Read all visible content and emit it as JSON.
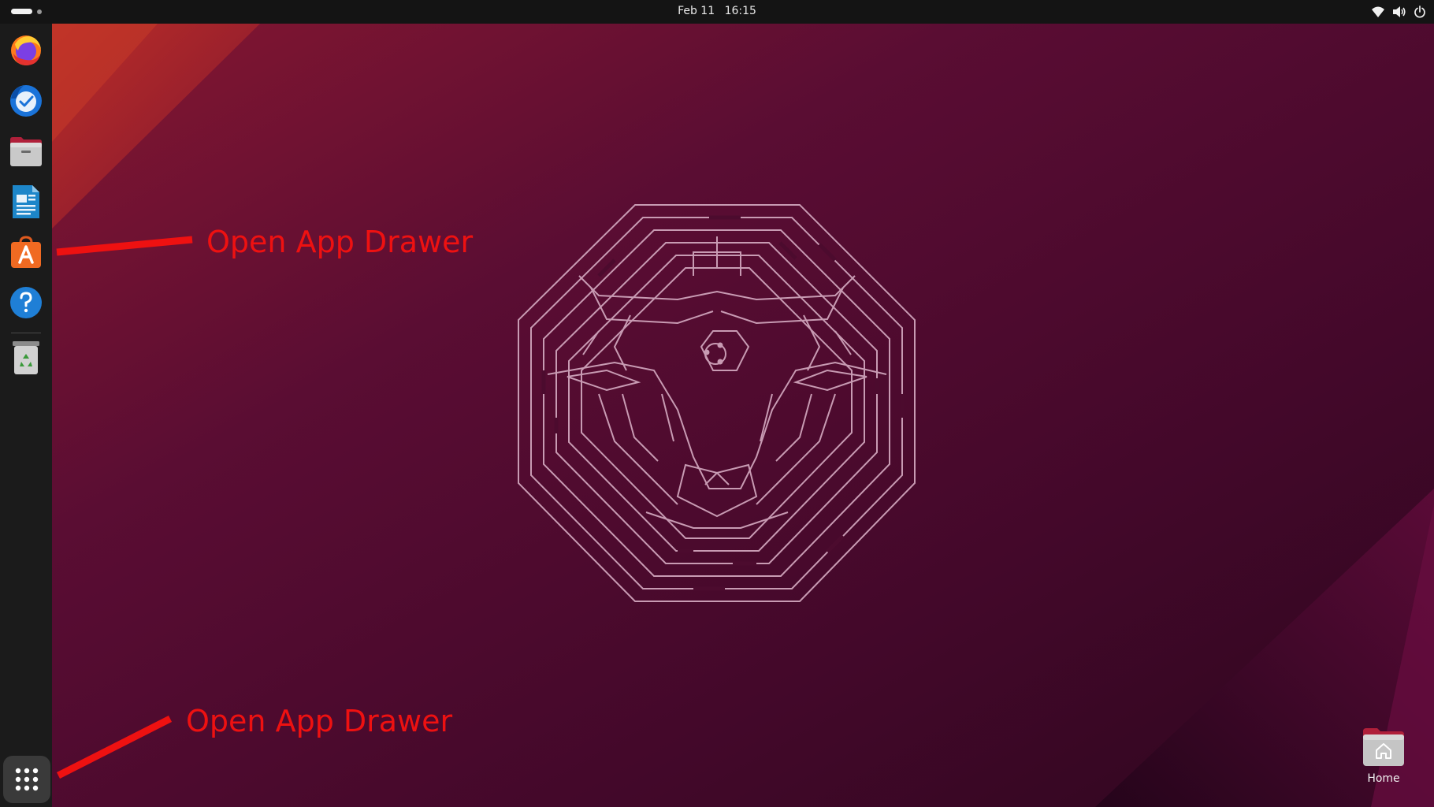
{
  "topbar": {
    "activities_icon": "activities-workspace-indicator",
    "date": "Feb 11",
    "time": "16:15",
    "tray_icons": [
      "wifi-icon",
      "volume-icon",
      "power-icon"
    ]
  },
  "dock": {
    "apps": [
      {
        "name": "Firefox",
        "icon": "firefox-icon"
      },
      {
        "name": "Thunderbird",
        "icon": "thunderbird-icon"
      },
      {
        "name": "Files",
        "icon": "files-icon"
      },
      {
        "name": "LibreOffice Writer",
        "icon": "libreoffice-writer-icon"
      },
      {
        "name": "Ubuntu Software",
        "icon": "app-center-icon"
      },
      {
        "name": "Help",
        "icon": "help-icon"
      },
      {
        "name": "Trash",
        "icon": "trash-icon"
      }
    ],
    "show_apps_icon": "app-grid-icon"
  },
  "annotations": [
    {
      "text": "Open App Drawer"
    },
    {
      "text": "Open App Drawer"
    }
  ],
  "desktop": {
    "home": {
      "label": "Home",
      "icon": "home-folder-icon"
    }
  },
  "colors": {
    "annotation": "#ee1111",
    "topbar": "#141414",
    "dock": "#1b1b1b",
    "wallpaper_base": "#4a0b2b",
    "maze_line": "#c89bb3"
  }
}
